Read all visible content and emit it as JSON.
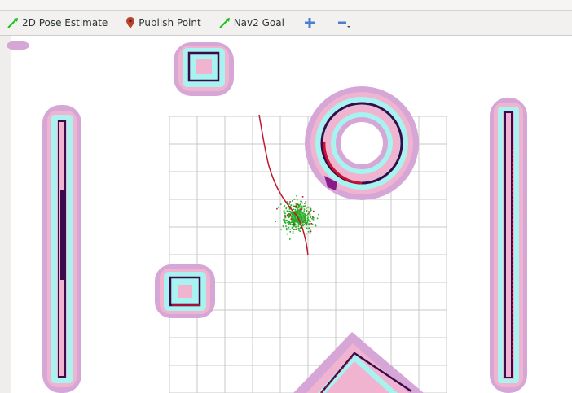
{
  "toolbar": {
    "tools": [
      {
        "label": "2D Pose Estimate",
        "icon": "green-arrow-icon"
      },
      {
        "label": "Publish Point",
        "icon": "map-pin-icon"
      },
      {
        "label": "Nav2 Goal",
        "icon": "green-arrow-icon"
      }
    ],
    "zoom_in_icon": "plus-icon",
    "zoom_out_icon": "minus-icon"
  },
  "colors": {
    "costmap_outer": "#d6a6d6",
    "costmap_inner": "#f0b4d0",
    "inflation_cyan": "#a8f2f0",
    "obstacle": "#3a0a4a",
    "laser_red": "#cc1030",
    "particles": "#22b022",
    "grid": "#c8c8c8",
    "path": "#c0182e"
  }
}
